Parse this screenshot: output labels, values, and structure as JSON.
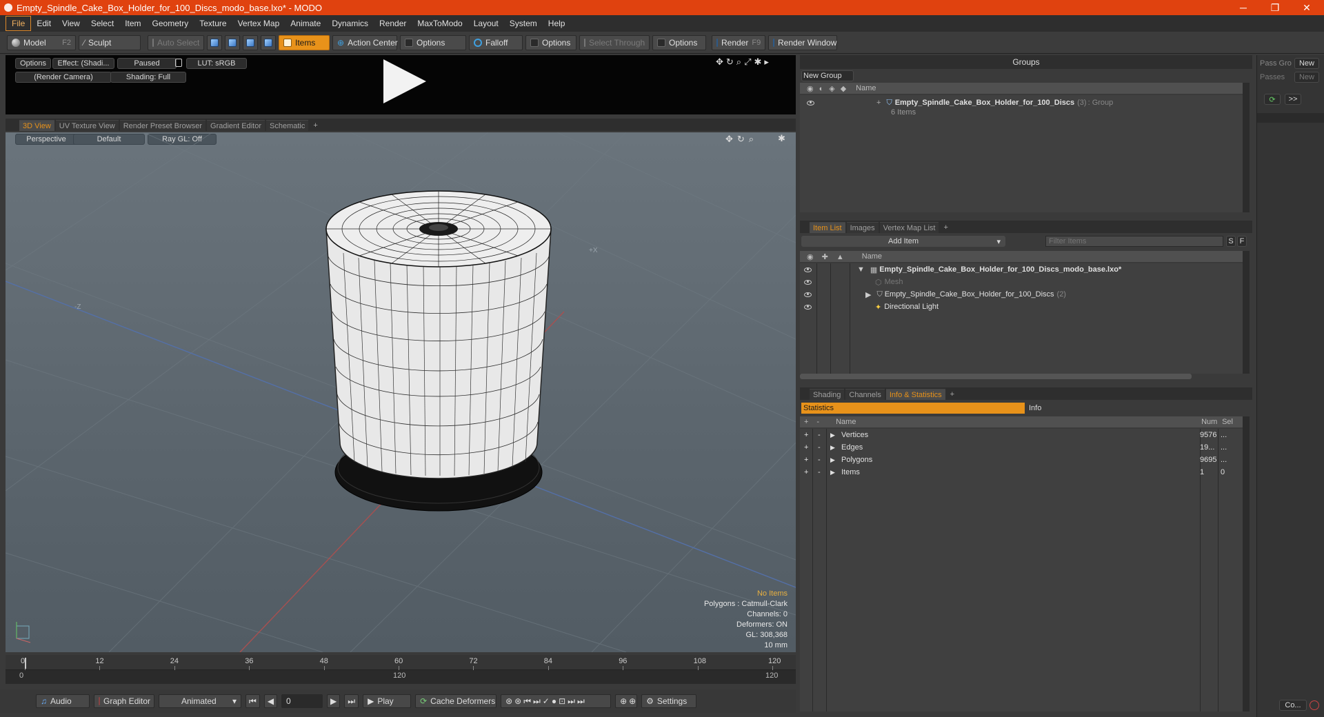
{
  "window": {
    "title": "Empty_Spindle_Cake_Box_Holder_for_100_Discs_modo_base.lxo* - MODO",
    "controls": [
      "─",
      "❐",
      "✕"
    ]
  },
  "menu": [
    "File",
    "Edit",
    "View",
    "Select",
    "Item",
    "Geometry",
    "Texture",
    "Vertex Map",
    "Animate",
    "Dynamics",
    "Render",
    "MaxToModo",
    "Layout",
    "System",
    "Help"
  ],
  "toolbar": {
    "model": "Model",
    "model_key": "F2",
    "sculpt": "Sculpt",
    "auto_select": "Auto Select",
    "items": "Items",
    "action_center": "Action Center",
    "options1": "Options",
    "falloff": "Falloff",
    "options2": "Options",
    "select_through": "Select Through",
    "options3": "Options",
    "render": "Render",
    "render_key": "F9",
    "render_window": "Render Window"
  },
  "preview": {
    "options": "Options",
    "effect": "Effect: (Shadi...",
    "paused": "Paused",
    "lut": "LUT: sRGB",
    "camera": "(Render Camera)",
    "shading": "Shading: Full"
  },
  "viewport_tabs": [
    "3D View",
    "UV Texture View",
    "Render Preset Browser",
    "Gradient Editor",
    "Schematic",
    "+"
  ],
  "viewport": {
    "perspective": "Perspective",
    "default": "Default",
    "raygl": "Ray GL: Off",
    "axis_x": "+X",
    "axis_z": "-Z",
    "info": {
      "no_items": "No Items",
      "polygons": "Polygons : Catmull-Clark",
      "channels": "Channels: 0",
      "deformers": "Deformers: ON",
      "gl": "GL: 308,368",
      "scale": "10 mm"
    }
  },
  "timeline": {
    "ticks": [
      "0",
      "12",
      "24",
      "36",
      "48",
      "60",
      "72",
      "84",
      "96",
      "108",
      "120"
    ],
    "range_start": "0",
    "range_mid": "120",
    "range_end": "120"
  },
  "bottom": {
    "audio": "Audio",
    "graph_editor": "Graph Editor",
    "animated": "Animated",
    "frame": "0",
    "play": "Play",
    "cache_deformers": "Cache Deformers",
    "settings": "Settings"
  },
  "groups": {
    "title": "Groups",
    "new_group": "New Group",
    "col_name": "Name",
    "item_name": "Empty_Spindle_Cake_Box_Holder_for_100_Discs",
    "item_count": "(3)",
    "item_type": ": Group",
    "item_sub": "6 Items"
  },
  "item_list": {
    "tabs": [
      "Item List",
      "Images",
      "Vertex Map List",
      "+"
    ],
    "add_item": "Add Item",
    "filter_placeholder": "Filter Items",
    "s": "S",
    "f": "F",
    "col_name": "Name",
    "rows": [
      {
        "label": "Empty_Spindle_Cake_Box_Holder_for_100_Discs_modo_base.lxo*",
        "extra": ""
      },
      {
        "label": "Mesh",
        "extra": ""
      },
      {
        "label": "Empty_Spindle_Cake_Box_Holder_for_100_Discs",
        "extra": "(2)"
      },
      {
        "label": "Directional Light",
        "extra": ""
      }
    ]
  },
  "stats": {
    "tabs": [
      "Shading",
      "Channels",
      "Info & Statistics",
      "+"
    ],
    "statistics": "Statistics",
    "info": "Info",
    "col_name": "Name",
    "col_num": "Num",
    "col_sel": "Sel",
    "rows": [
      {
        "name": "Vertices",
        "num": "9576",
        "sel": "..."
      },
      {
        "name": "Edges",
        "num": "19...",
        "sel": "..."
      },
      {
        "name": "Polygons",
        "num": "9695",
        "sel": "..."
      },
      {
        "name": "Items",
        "num": "1",
        "sel": "0"
      }
    ]
  },
  "pass": {
    "pass_group": "Pass Gro",
    "passes": "Passes",
    "new1": "New",
    "new2": "New",
    "next": ">>",
    "co": "Co..."
  }
}
